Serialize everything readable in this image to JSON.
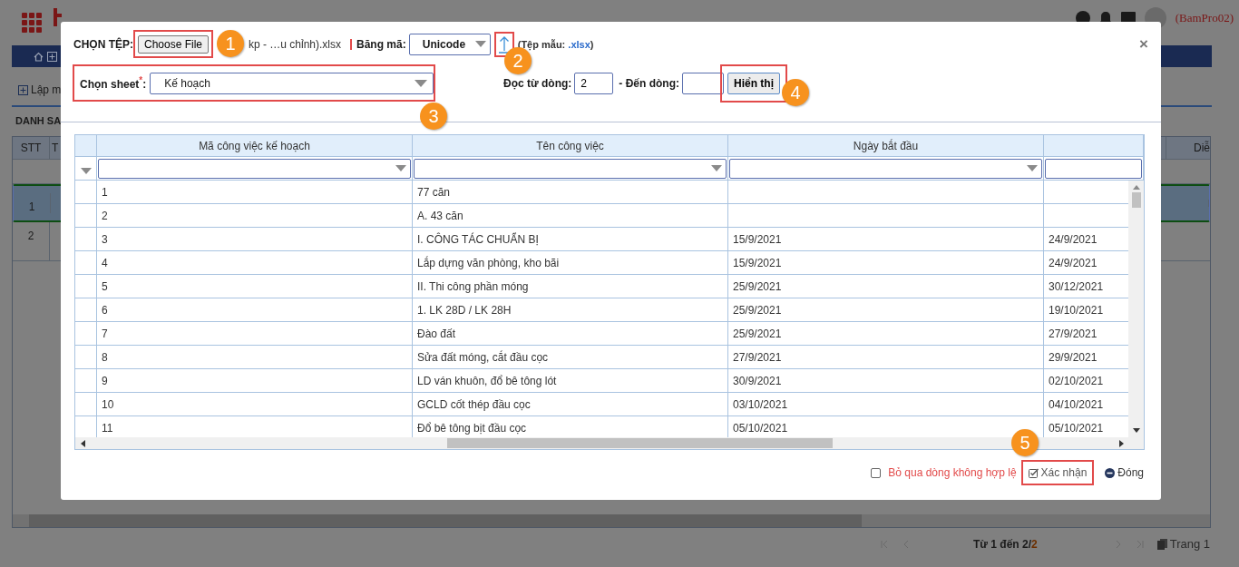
{
  "header": {
    "user": "(BamPro02)"
  },
  "toolbar": {
    "add_label": "Lập m"
  },
  "list": {
    "title": "DANH SA",
    "columns": [
      "STT",
      "T",
      "Diễ"
    ],
    "rows": [
      {
        "stt": "1",
        "selected": true
      },
      {
        "stt": "2",
        "selected": false
      }
    ]
  },
  "pager": {
    "range": "Từ 1 đến 2/",
    "total": "2",
    "page": "Trang 1"
  },
  "dialog": {
    "file_label": "CHỌN TỆP:",
    "choose_button": "Choose File",
    "file_name": "kp - …u chỉnh).xlsx",
    "encoding_label": "Băng mã:",
    "encoding": "Unicode",
    "template_label": "(Tệp mẫu:",
    "template_link": ".xlsx",
    "template_end": ")",
    "close": "×",
    "sheet_label": "Chọn sheet$^{*}$:",
    "sheet": "Kế hoạch",
    "from_label": "Đọc từ dòng:",
    "from_value": "2",
    "to_label": "- Đến dòng:",
    "show_button": "Hiển thị",
    "columns": [
      "Mã công việc kế hoạch",
      "Tên công việc",
      "Ngày bắt đầu"
    ],
    "rows": [
      {
        "cells": [
          "1",
          "77 căn"
        ]
      },
      {
        "cells": [
          "2",
          "A. 43 căn"
        ]
      },
      {
        "cells": [
          "3",
          "I. CÔNG TÁC CHUẨN BỊ",
          "15/9/2021",
          "24/9/2021"
        ]
      },
      {
        "cells": [
          "4",
          "Lắp dựng văn phòng, kho bãi",
          "15/9/2021",
          "24/9/2021"
        ]
      },
      {
        "cells": [
          "5",
          "II. Thi công phần móng",
          "25/9/2021",
          "30/12/2021"
        ]
      },
      {
        "cells": [
          "6",
          "1. LK 28D / LK 28H",
          "25/9/2021",
          "19/10/2021"
        ]
      },
      {
        "cells": [
          "7",
          "Đào đất",
          "25/9/2021",
          "27/9/2021"
        ]
      },
      {
        "cells": [
          "8",
          "Sửa đất móng, cắt đầu cọc",
          "27/9/2021",
          "29/9/2021"
        ]
      },
      {
        "cells": [
          "9",
          "LD ván khuôn, đổ bê tông lót",
          "30/9/2021",
          "02/10/2021"
        ]
      },
      {
        "cells": [
          "10",
          "GCLD cốt thép đầu cọc",
          "03/10/2021",
          "04/10/2021"
        ]
      },
      {
        "cells": [
          "11",
          "Đổ bê tông bịt đầu cọc",
          "05/10/2021",
          "05/10/2021"
        ]
      }
    ],
    "skip_invalid": {
      "label": "Bỏ qua dòng không hợp lệ",
      "checked": false
    },
    "confirm_button": "Xác nhận",
    "close_button": "Đóng"
  },
  "callouts": [
    "1",
    "2",
    "3",
    "4",
    "5"
  ]
}
